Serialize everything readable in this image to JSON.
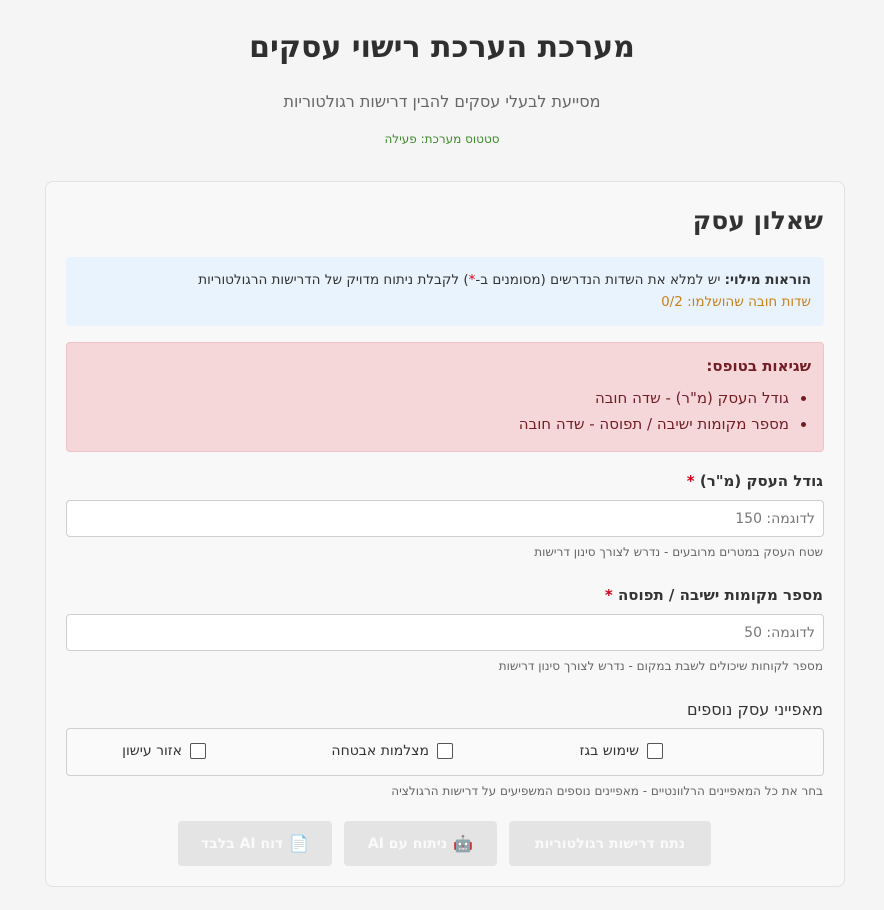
{
  "header": {
    "title": "מערכת הערכת רישוי עסקים",
    "subtitle": "מסייעת לבעלי עסקים להבין דרישות רגולטוריות",
    "status": "סטטוס מערכת: פעילה"
  },
  "form": {
    "title": "שאלון עסק",
    "instructions": {
      "label": "הוראות מילוי:",
      "text_before_star": "יש למלא את השדות הנדרשים (מסומנים ב-",
      "star": "*",
      "text_after_star": ") לקבלת ניתוח מדויק של הדרישות הרגולטוריות",
      "progress": "שדות חובה שהושלמו: 0/2"
    },
    "errors": {
      "title": "שגיאות בטופס:",
      "items": [
        "גודל העסק (מ\"ר) - שדה חובה",
        "מספר מקומות ישיבה / תפוסה - שדה חובה"
      ]
    },
    "size_field": {
      "label": "גודל העסק (מ\"ר)",
      "required_mark": "*",
      "placeholder": "לדוגמה: 150",
      "value": "",
      "hint": "שטח העסק במטרים מרובעים - נדרש לצורך סינון דרישות"
    },
    "seats_field": {
      "label": "מספר מקומות ישיבה / תפוסה",
      "required_mark": "*",
      "placeholder": "לדוגמה: 50",
      "value": "",
      "hint": "מספר לקוחות שיכולים לשבת במקום - נדרש לצורך סינון דרישות"
    },
    "features": {
      "label": "מאפייני עסק נוספים",
      "options": [
        {
          "label": "שימוש בגז",
          "checked": false
        },
        {
          "label": "מצלמות אבטחה",
          "checked": false
        },
        {
          "label": "אזור עישון",
          "checked": false
        }
      ],
      "hint": "בחר את כל המאפיינים הרלוונטיים - מאפיינים נוספים המשפיעים על דרישות הרגולציה"
    },
    "buttons": {
      "analyze": "נתח דרישות רגולטוריות",
      "ai_analysis": "ניתוח עם AI",
      "ai_analysis_icon": "robot-icon",
      "ai_report": "דוח AI בלבד",
      "ai_report_icon": "document-icon"
    }
  }
}
